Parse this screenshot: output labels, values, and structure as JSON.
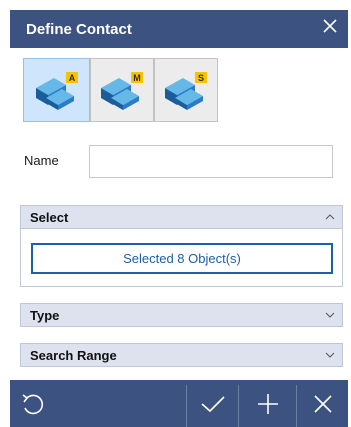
{
  "dialog": {
    "title": "Define Contact",
    "close_icon": "close-icon"
  },
  "modes": [
    {
      "badge": "A",
      "icon": "contact-auto-icon",
      "selected": true
    },
    {
      "badge": "M",
      "icon": "contact-manual-icon",
      "selected": false
    },
    {
      "badge": "S",
      "icon": "contact-surface-icon",
      "selected": false
    }
  ],
  "name_field": {
    "label": "Name",
    "value": "",
    "placeholder": ""
  },
  "sections": {
    "select": {
      "title": "Select",
      "button_label": "Selected 8 Object(s)",
      "expanded": true
    },
    "type": {
      "title": "Type",
      "expanded": false
    },
    "search_range": {
      "title": "Search Range",
      "expanded": false
    }
  },
  "footer": {
    "buttons": [
      "reset-icon",
      "ok-check-icon",
      "add-plus-icon",
      "cancel-x-icon"
    ]
  },
  "colors": {
    "header_bg": "#3c5280",
    "section_bg": "#dde2ee",
    "accent_blue": "#1d5fa8",
    "selected_mode_bg": "#cfe5fb",
    "badge_yellow": "#f5c400"
  }
}
